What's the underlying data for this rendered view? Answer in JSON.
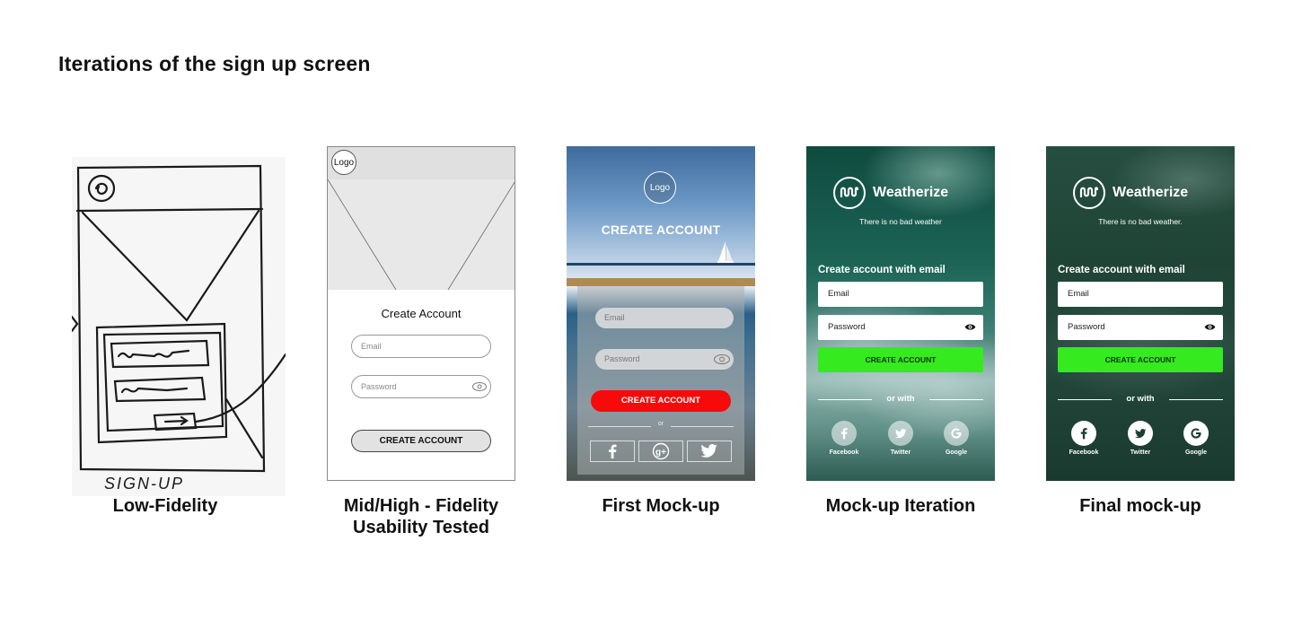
{
  "page": {
    "title": "Iterations of the sign up screen"
  },
  "lowfi": {
    "caption": "Low-Fidelity",
    "sketch_text": "SIGN-UP"
  },
  "midfi": {
    "caption_line1": "Mid/High - Fidelity",
    "caption_line2": "Usability Tested",
    "logo": "Logo",
    "heading": "Create Account",
    "email_placeholder": "Email",
    "password_placeholder": "Password",
    "button": "CREATE ACCOUNT"
  },
  "first": {
    "caption": "First Mock-up",
    "logo": "Logo",
    "heading": "CREATE ACCOUNT",
    "email_placeholder": "Email",
    "password_placeholder": "Password",
    "button": "CREATE ACCOUNT",
    "or": "or",
    "social_icons": [
      "facebook-icon",
      "google-plus-icon",
      "twitter-icon"
    ]
  },
  "iteration": {
    "caption": "Mock-up Iteration",
    "brand": "Weatherize",
    "tagline": "There is no bad weather",
    "heading": "Create account with email",
    "email": "Email",
    "password": "Password",
    "button": "CREATE ACCOUNT",
    "or_with": "or with",
    "social": [
      {
        "label": "Facebook",
        "icon": "facebook-icon"
      },
      {
        "label": "Twitter",
        "icon": "twitter-icon"
      },
      {
        "label": "Google",
        "icon": "google-icon"
      }
    ]
  },
  "final": {
    "caption": "Final mock-up",
    "brand": "Weatherize",
    "tagline": "There is no bad weather.",
    "heading": "Create account with email",
    "email": "Email",
    "password": "Password",
    "button": "CREATE ACCOUNT",
    "or_with": "or with",
    "social": [
      {
        "label": "Facebook",
        "icon": "facebook-icon"
      },
      {
        "label": "Twitter",
        "icon": "twitter-icon"
      },
      {
        "label": "Google",
        "icon": "google-icon"
      }
    ]
  },
  "colors": {
    "red_button": "#f70a0a",
    "green_button": "#35ea1e"
  }
}
